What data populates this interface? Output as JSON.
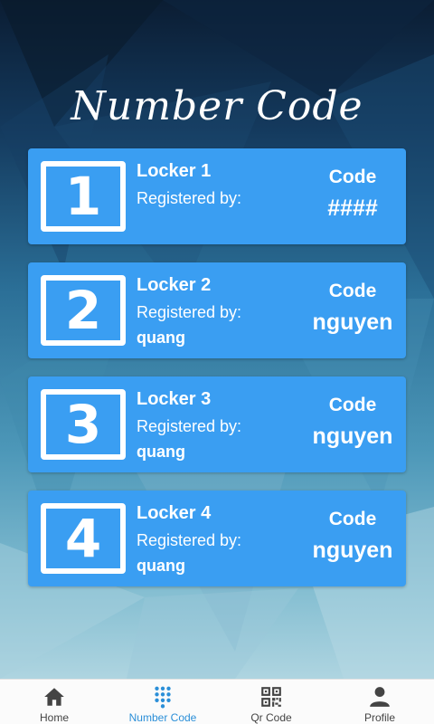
{
  "title": "Number Code",
  "lockers": [
    {
      "number": "1",
      "name": "Locker 1",
      "registered_label": "Registered by:",
      "registered_user": "",
      "code_label": "Code",
      "code_value": "####"
    },
    {
      "number": "2",
      "name": "Locker 2",
      "registered_label": "Registered by:",
      "registered_user": "quang",
      "code_label": "Code",
      "code_value": "nguyen"
    },
    {
      "number": "3",
      "name": "Locker 3",
      "registered_label": "Registered by:",
      "registered_user": "quang",
      "code_label": "Code",
      "code_value": "nguyen"
    },
    {
      "number": "4",
      "name": "Locker 4",
      "registered_label": "Registered by:",
      "registered_user": "quang",
      "code_label": "Code",
      "code_value": "nguyen"
    }
  ],
  "nav": [
    {
      "label": "Home",
      "icon": "home-icon",
      "active": false
    },
    {
      "label": "Number Code",
      "icon": "dialpad-icon",
      "active": true
    },
    {
      "label": "Qr Code",
      "icon": "qr-code-icon",
      "active": false
    },
    {
      "label": "Profile",
      "icon": "person-icon",
      "active": false
    }
  ],
  "colors": {
    "card": "#3a9ef2",
    "active_nav": "#2b8fd8",
    "inactive_nav": "#444444"
  }
}
